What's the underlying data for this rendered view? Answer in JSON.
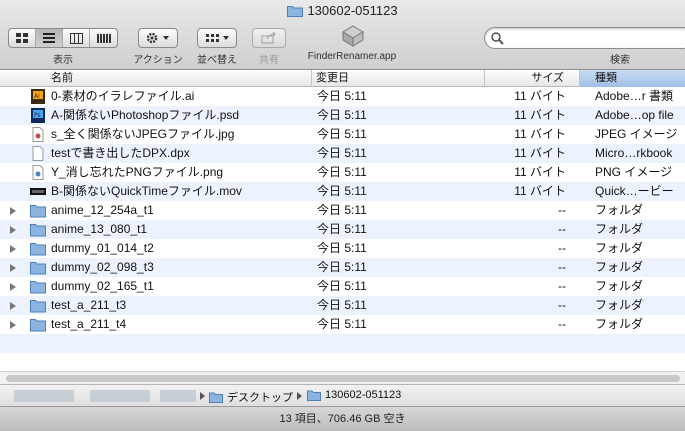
{
  "window": {
    "title": "130602-051123"
  },
  "toolbar": {
    "view_label": "表示",
    "action_label": "アクション",
    "arrange_label": "並べ替え",
    "share_label": "共有",
    "app_label": "FinderRenamer.app",
    "search_label": "検索",
    "search_placeholder": ""
  },
  "columns": {
    "name": "名前",
    "date": "変更日",
    "size": "サイズ",
    "kind": "種類"
  },
  "files": [
    {
      "name": "0-素材のイラレファイル.ai",
      "date": "今日 5:11",
      "size": "11 バイト",
      "kind": "Adobe…r 書類",
      "icon": "illustrator-file-icon"
    },
    {
      "name": "A-関係ないPhotoshopファイル.psd",
      "date": "今日 5:11",
      "size": "11 バイト",
      "kind": "Adobe…op file",
      "icon": "photoshop-file-icon"
    },
    {
      "name": "s_全く関係ないJPEGファイル.jpg",
      "date": "今日 5:11",
      "size": "11 バイト",
      "kind": "JPEG イメージ",
      "icon": "image-file-icon"
    },
    {
      "name": "testで書き出したDPX.dpx",
      "date": "今日 5:11",
      "size": "11 バイト",
      "kind": "Micro…rkbook",
      "icon": "document-file-icon"
    },
    {
      "name": "Y_消し忘れたPNGファイル.png",
      "date": "今日 5:11",
      "size": "11 バイト",
      "kind": "PNG イメージ",
      "icon": "image-file-icon"
    },
    {
      "name": "B-関係ないQuickTimeファイル.mov",
      "date": "今日 5:11",
      "size": "11 バイト",
      "kind": "Quick…ービー",
      "icon": "movie-file-icon"
    }
  ],
  "folders": [
    {
      "name": "anime_12_254a_t1",
      "date": "今日 5:11",
      "size": "--",
      "kind": "フォルダ"
    },
    {
      "name": "anime_13_080_t1",
      "date": "今日 5:11",
      "size": "--",
      "kind": "フォルダ"
    },
    {
      "name": "dummy_01_014_t2",
      "date": "今日 5:11",
      "size": "--",
      "kind": "フォルダ"
    },
    {
      "name": "dummy_02_098_t3",
      "date": "今日 5:11",
      "size": "--",
      "kind": "フォルダ"
    },
    {
      "name": "dummy_02_165_t1",
      "date": "今日 5:11",
      "size": "--",
      "kind": "フォルダ"
    },
    {
      "name": "test_a_211_t3",
      "date": "今日 5:11",
      "size": "--",
      "kind": "フォルダ"
    },
    {
      "name": "test_a_211_t4",
      "date": "今日 5:11",
      "size": "--",
      "kind": "フォルダ"
    }
  ],
  "path": {
    "desktop": "デスクトップ",
    "folder": "130602-051123"
  },
  "status": "13 項目、706.46 GB 空き",
  "colors": {
    "folder": "#7aa7d8",
    "row_alt": "#edf3fe",
    "sorted_header": "#a9c6ea"
  }
}
